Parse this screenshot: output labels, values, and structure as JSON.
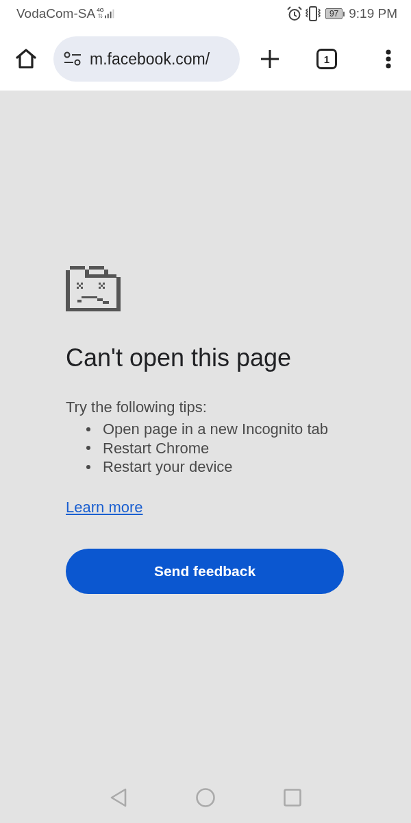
{
  "status_bar": {
    "carrier": "VodaCom-SA",
    "network": "4G",
    "battery": "97",
    "time": "9:19 PM"
  },
  "toolbar": {
    "url": "m.facebook.com/",
    "tab_count": "1"
  },
  "error_page": {
    "title": "Can't open this page",
    "tips_heading": "Try the following tips:",
    "tips": [
      "Open page in a new Incognito tab",
      "Restart Chrome",
      "Restart your device"
    ],
    "link": "Learn more",
    "button": "Send feedback"
  }
}
